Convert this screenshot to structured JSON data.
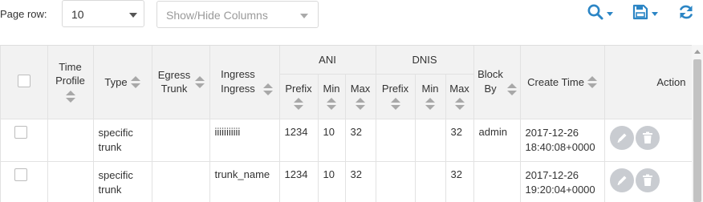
{
  "toolbar": {
    "page_row_label": "Page row:",
    "page_row_value": "10",
    "columns_placeholder": "Show/Hide Columns",
    "search_icon": "search-icon",
    "save_icon": "save-icon",
    "refresh_icon": "refresh-icon",
    "accent_color": "#2b85c5"
  },
  "table": {
    "headers": {
      "time_profile": "Time Profile",
      "type": "Type",
      "egress_trunk": "Egress Trunk",
      "ingress": "Ingress Ingress",
      "ani": "ANI",
      "dnis": "DNIS",
      "prefix": "Prefix",
      "min": "Min",
      "max": "Max",
      "block_by": "Block By",
      "create_time": "Create Time",
      "action": "Action"
    },
    "rows": [
      {
        "time_profile": "",
        "type": "specific trunk",
        "egress_trunk": "",
        "ingress": "iiiiiiiiiii",
        "ani_prefix": "1234",
        "ani_min": "10",
        "ani_max": "32",
        "dnis_prefix": "",
        "dnis_min": "",
        "dnis_max": "32",
        "block_by": "admin",
        "create_time": "2017-12-26 18:40:08+0000"
      },
      {
        "time_profile": "",
        "type": "specific trunk",
        "egress_trunk": "",
        "ingress": "trunk_name",
        "ani_prefix": "1234",
        "ani_min": "10",
        "ani_max": "32",
        "dnis_prefix": "",
        "dnis_min": "",
        "dnis_max": "32",
        "block_by": "",
        "create_time": "2017-12-26 19:20:04+0000"
      }
    ],
    "action_icons": [
      "edit-icon",
      "delete-icon"
    ]
  }
}
